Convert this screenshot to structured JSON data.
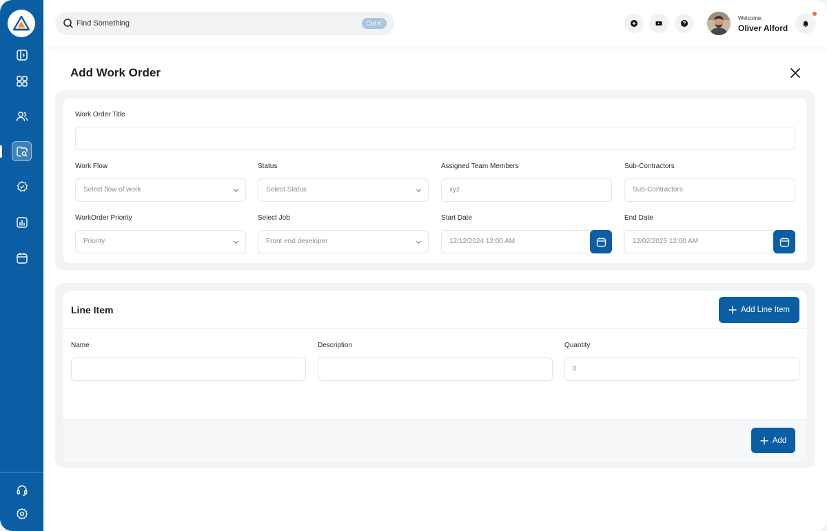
{
  "colors": {
    "brand": "#0b5ea4",
    "notification_dot": "#ef6b4a"
  },
  "sidebar": {
    "items": [
      {
        "icon": "sidebar-toggle-icon"
      },
      {
        "icon": "grid-icon"
      },
      {
        "icon": "users-icon"
      },
      {
        "icon": "work-orders-icon",
        "active": true
      },
      {
        "icon": "badge-icon"
      },
      {
        "icon": "reports-icon"
      },
      {
        "icon": "calendar-icon"
      }
    ],
    "bottom": [
      {
        "icon": "headset-icon"
      },
      {
        "icon": "gear-icon"
      }
    ]
  },
  "search": {
    "placeholder": "Find Something",
    "shortcut": "Ctrl K"
  },
  "header": {
    "buttons": [
      {
        "icon": "plus-icon"
      },
      {
        "icon": "video-icon"
      },
      {
        "icon": "help-icon"
      }
    ],
    "welcome": "Welcome,",
    "user_name": "Oliver Alford",
    "notifications": {
      "icon": "bell-icon",
      "has_unread": true
    }
  },
  "page": {
    "title": "Add Work Order"
  },
  "form": {
    "title_label": "Work Order Title",
    "title_value": "",
    "workflow": {
      "label": "Work Flow",
      "placeholder": "Select flow of work"
    },
    "status": {
      "label": "Status",
      "placeholder": "Select Status"
    },
    "team": {
      "label": "Assigned Team Members",
      "value": "xyz"
    },
    "subcontractors": {
      "label": "Sub-Contractors",
      "placeholder": "Sub-Contractors"
    },
    "priority": {
      "label": "WorkOrder Priority",
      "placeholder": "Priority"
    },
    "job": {
      "label": "Select Job",
      "value": "Front end developer"
    },
    "start_date": {
      "label": "Start Date",
      "value": "12/12/2024 12:00 AM"
    },
    "end_date": {
      "label": "End Date",
      "value": "12/02/2025 12:00 AM"
    }
  },
  "line_item": {
    "title": "Line Item",
    "add_line_label": "Add Line Item",
    "columns": {
      "name": "Name",
      "description": "Description",
      "quantity": "Quantity"
    },
    "row": {
      "name": "",
      "description": "",
      "quantity": "0"
    },
    "add_label": "Add"
  }
}
